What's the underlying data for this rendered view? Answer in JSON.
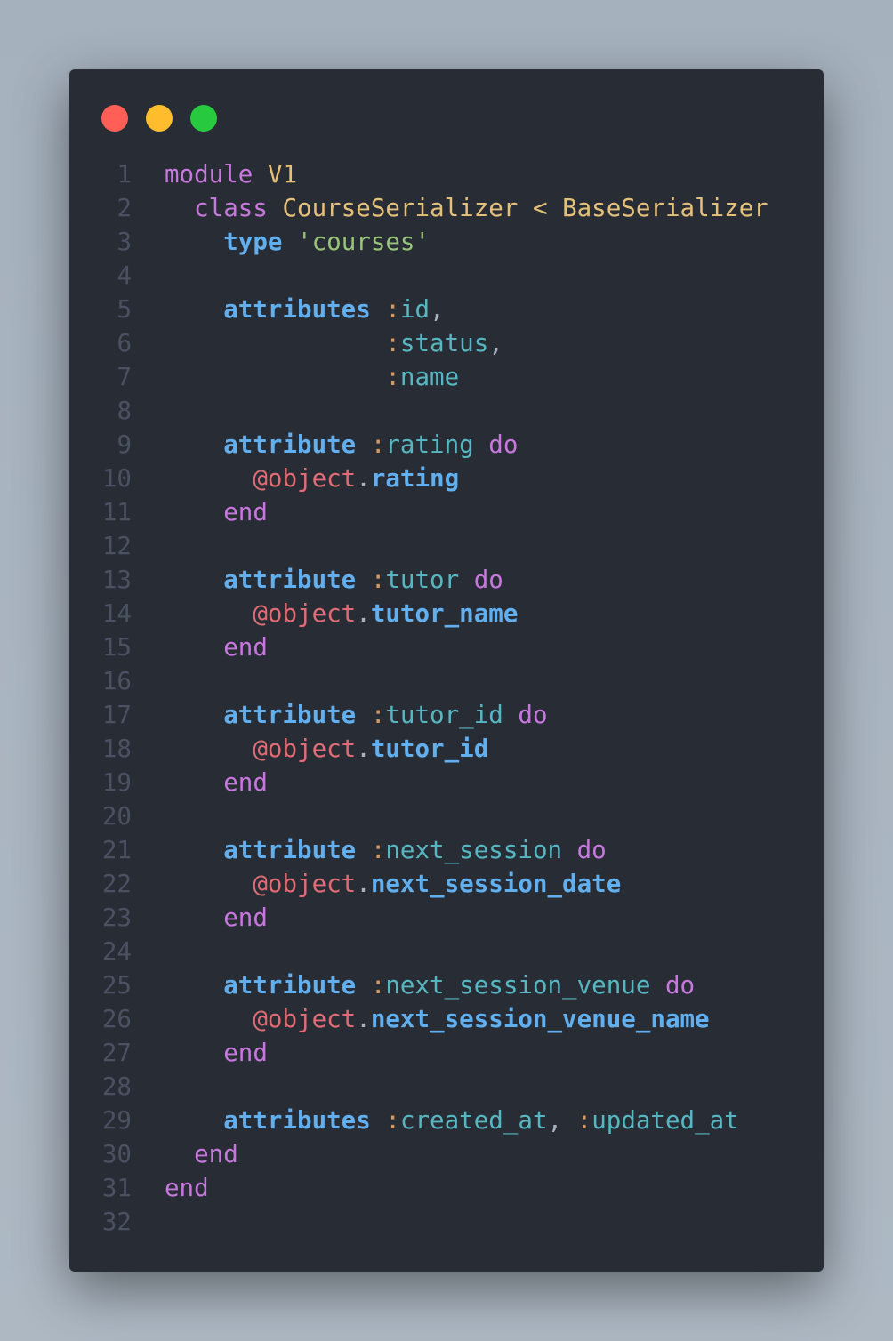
{
  "window": {
    "controls": [
      "close",
      "minimize",
      "maximize"
    ]
  },
  "colors": {
    "background": "#282c34",
    "keyword": "#c678dd",
    "constant": "#e5c07b",
    "method": "#61afef",
    "string": "#98c379",
    "symbol": "#56b6c2",
    "ivar": "#e06c75"
  },
  "lines": [
    {
      "n": "1",
      "tokens": [
        {
          "t": "module",
          "c": "kw"
        },
        {
          "t": " "
        },
        {
          "t": "V1",
          "c": "cn"
        }
      ]
    },
    {
      "n": "2",
      "tokens": [
        {
          "t": "  "
        },
        {
          "t": "class",
          "c": "kw"
        },
        {
          "t": " "
        },
        {
          "t": "CourseSerializer",
          "c": "cn"
        },
        {
          "t": " < ",
          "c": "cn"
        },
        {
          "t": "BaseSerializer",
          "c": "cn"
        }
      ]
    },
    {
      "n": "3",
      "tokens": [
        {
          "t": "    "
        },
        {
          "t": "type",
          "c": "fn"
        },
        {
          "t": " "
        },
        {
          "t": "'courses'",
          "c": "st"
        }
      ]
    },
    {
      "n": "4",
      "tokens": []
    },
    {
      "n": "5",
      "tokens": [
        {
          "t": "    "
        },
        {
          "t": "attributes",
          "c": "fn"
        },
        {
          "t": " "
        },
        {
          "t": ":",
          "c": "co"
        },
        {
          "t": "id",
          "c": "sy"
        },
        {
          "t": ",",
          "c": "pl"
        }
      ]
    },
    {
      "n": "6",
      "tokens": [
        {
          "t": "               "
        },
        {
          "t": ":",
          "c": "co"
        },
        {
          "t": "status",
          "c": "sy"
        },
        {
          "t": ",",
          "c": "pl"
        }
      ]
    },
    {
      "n": "7",
      "tokens": [
        {
          "t": "               "
        },
        {
          "t": ":",
          "c": "co"
        },
        {
          "t": "name",
          "c": "sy"
        }
      ]
    },
    {
      "n": "8",
      "tokens": []
    },
    {
      "n": "9",
      "tokens": [
        {
          "t": "    "
        },
        {
          "t": "attribute",
          "c": "fn"
        },
        {
          "t": " "
        },
        {
          "t": ":",
          "c": "co"
        },
        {
          "t": "rating",
          "c": "sy"
        },
        {
          "t": " "
        },
        {
          "t": "do",
          "c": "kw"
        }
      ]
    },
    {
      "n": "10",
      "tokens": [
        {
          "t": "      "
        },
        {
          "t": "@object",
          "c": "iv"
        },
        {
          "t": ".",
          "c": "pl"
        },
        {
          "t": "rating",
          "c": "fn"
        }
      ]
    },
    {
      "n": "11",
      "tokens": [
        {
          "t": "    "
        },
        {
          "t": "end",
          "c": "kw"
        }
      ]
    },
    {
      "n": "12",
      "tokens": []
    },
    {
      "n": "13",
      "tokens": [
        {
          "t": "    "
        },
        {
          "t": "attribute",
          "c": "fn"
        },
        {
          "t": " "
        },
        {
          "t": ":",
          "c": "co"
        },
        {
          "t": "tutor",
          "c": "sy"
        },
        {
          "t": " "
        },
        {
          "t": "do",
          "c": "kw"
        }
      ]
    },
    {
      "n": "14",
      "tokens": [
        {
          "t": "      "
        },
        {
          "t": "@object",
          "c": "iv"
        },
        {
          "t": ".",
          "c": "pl"
        },
        {
          "t": "tutor_name",
          "c": "fn"
        }
      ]
    },
    {
      "n": "15",
      "tokens": [
        {
          "t": "    "
        },
        {
          "t": "end",
          "c": "kw"
        }
      ]
    },
    {
      "n": "16",
      "tokens": []
    },
    {
      "n": "17",
      "tokens": [
        {
          "t": "    "
        },
        {
          "t": "attribute",
          "c": "fn"
        },
        {
          "t": " "
        },
        {
          "t": ":",
          "c": "co"
        },
        {
          "t": "tutor_id",
          "c": "sy"
        },
        {
          "t": " "
        },
        {
          "t": "do",
          "c": "kw"
        }
      ]
    },
    {
      "n": "18",
      "tokens": [
        {
          "t": "      "
        },
        {
          "t": "@object",
          "c": "iv"
        },
        {
          "t": ".",
          "c": "pl"
        },
        {
          "t": "tutor_id",
          "c": "fn"
        }
      ]
    },
    {
      "n": "19",
      "tokens": [
        {
          "t": "    "
        },
        {
          "t": "end",
          "c": "kw"
        }
      ]
    },
    {
      "n": "20",
      "tokens": []
    },
    {
      "n": "21",
      "tokens": [
        {
          "t": "    "
        },
        {
          "t": "attribute",
          "c": "fn"
        },
        {
          "t": " "
        },
        {
          "t": ":",
          "c": "co"
        },
        {
          "t": "next_session",
          "c": "sy"
        },
        {
          "t": " "
        },
        {
          "t": "do",
          "c": "kw"
        }
      ]
    },
    {
      "n": "22",
      "tokens": [
        {
          "t": "      "
        },
        {
          "t": "@object",
          "c": "iv"
        },
        {
          "t": ".",
          "c": "pl"
        },
        {
          "t": "next_session_date",
          "c": "fn"
        }
      ]
    },
    {
      "n": "23",
      "tokens": [
        {
          "t": "    "
        },
        {
          "t": "end",
          "c": "kw"
        }
      ]
    },
    {
      "n": "24",
      "tokens": []
    },
    {
      "n": "25",
      "tokens": [
        {
          "t": "    "
        },
        {
          "t": "attribute",
          "c": "fn"
        },
        {
          "t": " "
        },
        {
          "t": ":",
          "c": "co"
        },
        {
          "t": "next_session_venue",
          "c": "sy"
        },
        {
          "t": " "
        },
        {
          "t": "do",
          "c": "kw"
        }
      ]
    },
    {
      "n": "26",
      "tokens": [
        {
          "t": "      "
        },
        {
          "t": "@object",
          "c": "iv"
        },
        {
          "t": ".",
          "c": "pl"
        },
        {
          "t": "next_session_venue_name",
          "c": "fn"
        }
      ]
    },
    {
      "n": "27",
      "tokens": [
        {
          "t": "    "
        },
        {
          "t": "end",
          "c": "kw"
        }
      ]
    },
    {
      "n": "28",
      "tokens": []
    },
    {
      "n": "29",
      "tokens": [
        {
          "t": "    "
        },
        {
          "t": "attributes",
          "c": "fn"
        },
        {
          "t": " "
        },
        {
          "t": ":",
          "c": "co"
        },
        {
          "t": "created_at",
          "c": "sy"
        },
        {
          "t": ", ",
          "c": "pl"
        },
        {
          "t": ":",
          "c": "co"
        },
        {
          "t": "updated_at",
          "c": "sy"
        }
      ]
    },
    {
      "n": "30",
      "tokens": [
        {
          "t": "  "
        },
        {
          "t": "end",
          "c": "kw"
        }
      ]
    },
    {
      "n": "31",
      "tokens": [
        {
          "t": "end",
          "c": "kw"
        }
      ]
    },
    {
      "n": "32",
      "tokens": []
    }
  ]
}
